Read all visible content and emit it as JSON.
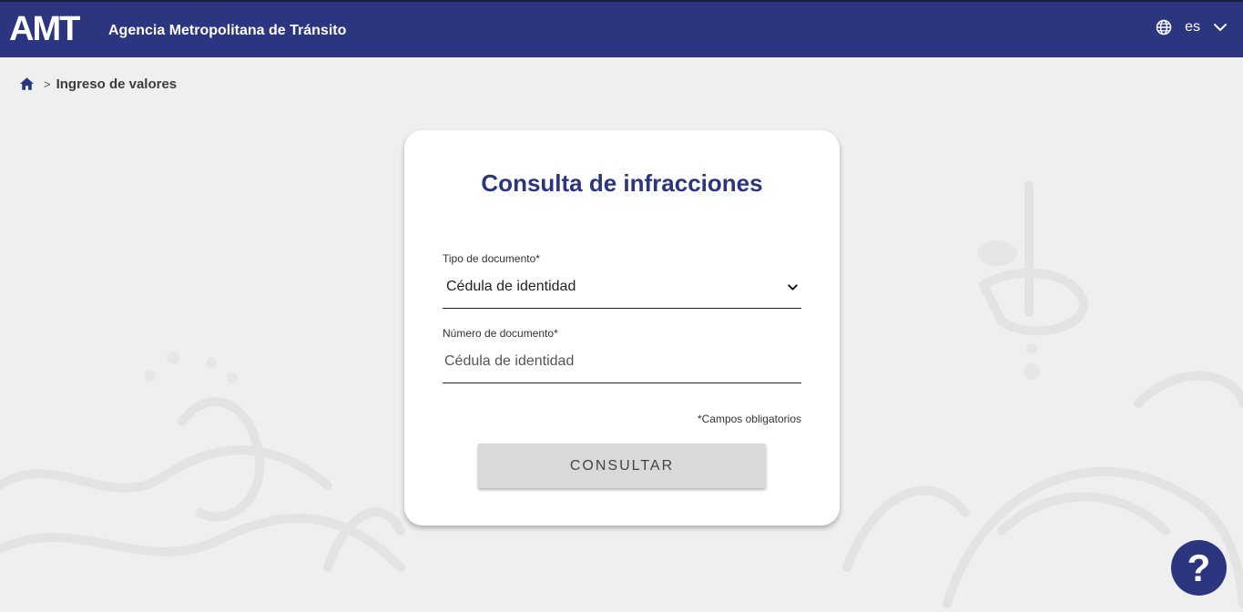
{
  "header": {
    "logo_text": "AMT",
    "agency_name": "Agencia Metropolitana de Tránsito",
    "language": "es",
    "background_color": "#2b3580"
  },
  "breadcrumb": {
    "separator": ">",
    "current": "Ingreso de valores"
  },
  "form": {
    "title": "Consulta de infracciones",
    "doc_type_label": "Tipo de documento*",
    "doc_type_value": "Cédula de identidad",
    "doc_number_label": "Número de documento*",
    "doc_number_placeholder": "Cédula de identidad",
    "doc_number_value": "",
    "required_note": "*Campos obligatorios",
    "submit_label": "CONSULTAR",
    "accent_color": "#2b3580"
  },
  "help": {
    "label": "?"
  },
  "icons": {
    "home": "home-icon",
    "globe": "globe-icon",
    "language_chevron": "chevron-down-icon",
    "select_chevron": "chevron-down-icon",
    "help": "question-icon"
  }
}
